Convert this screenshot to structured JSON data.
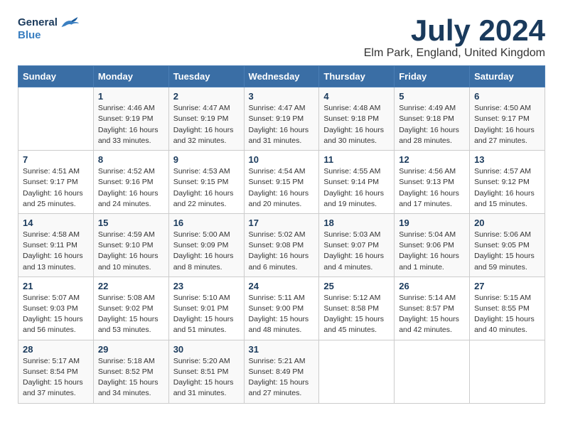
{
  "header": {
    "logo_line1": "General",
    "logo_line2": "Blue",
    "month": "July 2024",
    "location": "Elm Park, England, United Kingdom"
  },
  "weekdays": [
    "Sunday",
    "Monday",
    "Tuesday",
    "Wednesday",
    "Thursday",
    "Friday",
    "Saturday"
  ],
  "weeks": [
    [
      {
        "num": "",
        "info": ""
      },
      {
        "num": "1",
        "info": "Sunrise: 4:46 AM\nSunset: 9:19 PM\nDaylight: 16 hours\nand 33 minutes."
      },
      {
        "num": "2",
        "info": "Sunrise: 4:47 AM\nSunset: 9:19 PM\nDaylight: 16 hours\nand 32 minutes."
      },
      {
        "num": "3",
        "info": "Sunrise: 4:47 AM\nSunset: 9:19 PM\nDaylight: 16 hours\nand 31 minutes."
      },
      {
        "num": "4",
        "info": "Sunrise: 4:48 AM\nSunset: 9:18 PM\nDaylight: 16 hours\nand 30 minutes."
      },
      {
        "num": "5",
        "info": "Sunrise: 4:49 AM\nSunset: 9:18 PM\nDaylight: 16 hours\nand 28 minutes."
      },
      {
        "num": "6",
        "info": "Sunrise: 4:50 AM\nSunset: 9:17 PM\nDaylight: 16 hours\nand 27 minutes."
      }
    ],
    [
      {
        "num": "7",
        "info": "Sunrise: 4:51 AM\nSunset: 9:17 PM\nDaylight: 16 hours\nand 25 minutes."
      },
      {
        "num": "8",
        "info": "Sunrise: 4:52 AM\nSunset: 9:16 PM\nDaylight: 16 hours\nand 24 minutes."
      },
      {
        "num": "9",
        "info": "Sunrise: 4:53 AM\nSunset: 9:15 PM\nDaylight: 16 hours\nand 22 minutes."
      },
      {
        "num": "10",
        "info": "Sunrise: 4:54 AM\nSunset: 9:15 PM\nDaylight: 16 hours\nand 20 minutes."
      },
      {
        "num": "11",
        "info": "Sunrise: 4:55 AM\nSunset: 9:14 PM\nDaylight: 16 hours\nand 19 minutes."
      },
      {
        "num": "12",
        "info": "Sunrise: 4:56 AM\nSunset: 9:13 PM\nDaylight: 16 hours\nand 17 minutes."
      },
      {
        "num": "13",
        "info": "Sunrise: 4:57 AM\nSunset: 9:12 PM\nDaylight: 16 hours\nand 15 minutes."
      }
    ],
    [
      {
        "num": "14",
        "info": "Sunrise: 4:58 AM\nSunset: 9:11 PM\nDaylight: 16 hours\nand 13 minutes."
      },
      {
        "num": "15",
        "info": "Sunrise: 4:59 AM\nSunset: 9:10 PM\nDaylight: 16 hours\nand 10 minutes."
      },
      {
        "num": "16",
        "info": "Sunrise: 5:00 AM\nSunset: 9:09 PM\nDaylight: 16 hours\nand 8 minutes."
      },
      {
        "num": "17",
        "info": "Sunrise: 5:02 AM\nSunset: 9:08 PM\nDaylight: 16 hours\nand 6 minutes."
      },
      {
        "num": "18",
        "info": "Sunrise: 5:03 AM\nSunset: 9:07 PM\nDaylight: 16 hours\nand 4 minutes."
      },
      {
        "num": "19",
        "info": "Sunrise: 5:04 AM\nSunset: 9:06 PM\nDaylight: 16 hours\nand 1 minute."
      },
      {
        "num": "20",
        "info": "Sunrise: 5:06 AM\nSunset: 9:05 PM\nDaylight: 15 hours\nand 59 minutes."
      }
    ],
    [
      {
        "num": "21",
        "info": "Sunrise: 5:07 AM\nSunset: 9:03 PM\nDaylight: 15 hours\nand 56 minutes."
      },
      {
        "num": "22",
        "info": "Sunrise: 5:08 AM\nSunset: 9:02 PM\nDaylight: 15 hours\nand 53 minutes."
      },
      {
        "num": "23",
        "info": "Sunrise: 5:10 AM\nSunset: 9:01 PM\nDaylight: 15 hours\nand 51 minutes."
      },
      {
        "num": "24",
        "info": "Sunrise: 5:11 AM\nSunset: 9:00 PM\nDaylight: 15 hours\nand 48 minutes."
      },
      {
        "num": "25",
        "info": "Sunrise: 5:12 AM\nSunset: 8:58 PM\nDaylight: 15 hours\nand 45 minutes."
      },
      {
        "num": "26",
        "info": "Sunrise: 5:14 AM\nSunset: 8:57 PM\nDaylight: 15 hours\nand 42 minutes."
      },
      {
        "num": "27",
        "info": "Sunrise: 5:15 AM\nSunset: 8:55 PM\nDaylight: 15 hours\nand 40 minutes."
      }
    ],
    [
      {
        "num": "28",
        "info": "Sunrise: 5:17 AM\nSunset: 8:54 PM\nDaylight: 15 hours\nand 37 minutes."
      },
      {
        "num": "29",
        "info": "Sunrise: 5:18 AM\nSunset: 8:52 PM\nDaylight: 15 hours\nand 34 minutes."
      },
      {
        "num": "30",
        "info": "Sunrise: 5:20 AM\nSunset: 8:51 PM\nDaylight: 15 hours\nand 31 minutes."
      },
      {
        "num": "31",
        "info": "Sunrise: 5:21 AM\nSunset: 8:49 PM\nDaylight: 15 hours\nand 27 minutes."
      },
      {
        "num": "",
        "info": ""
      },
      {
        "num": "",
        "info": ""
      },
      {
        "num": "",
        "info": ""
      }
    ]
  ]
}
